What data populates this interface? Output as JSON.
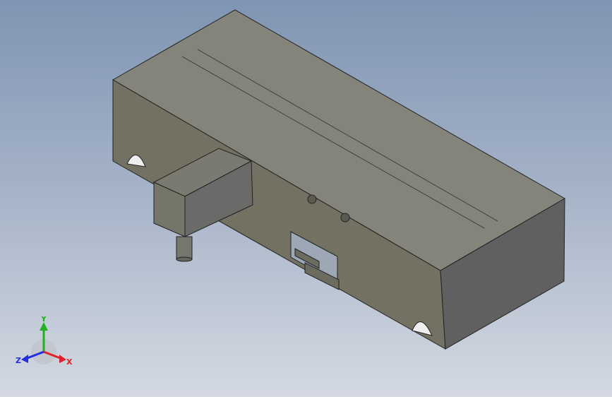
{
  "triad": {
    "x_label": "X",
    "y_label": "Y",
    "z_label": "Z",
    "x_color": "#e0202a",
    "y_color": "#20b020",
    "z_color": "#2030e0"
  },
  "model": {
    "panel_color": "#727261",
    "top_color": "#83837a",
    "end_color": "#5f5f5f",
    "block_color": "#6a6a68"
  }
}
